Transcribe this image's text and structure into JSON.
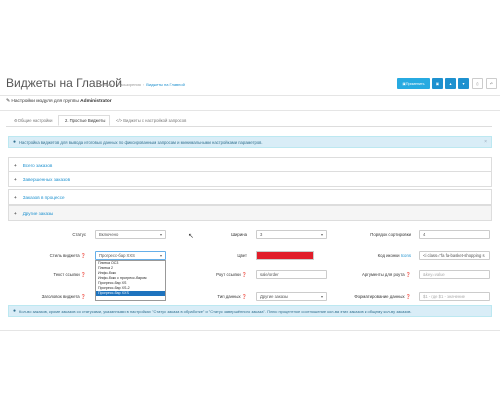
{
  "header": {
    "title": "Виджеты на Главной",
    "breadcrumb": [
      "Главная",
      "Расширения",
      "Виджеты на Главной"
    ]
  },
  "toolbar": {
    "apply_label": "Применить",
    "save_icon": "save-icon",
    "copy_icon": "copy-icon",
    "download_icon": "download-icon",
    "file_icon": "file-icon",
    "back_icon": "back-icon"
  },
  "panel": {
    "heading_prefix": "Настройки модуля для группы",
    "heading_group": "Administrator"
  },
  "tabs": [
    {
      "label": "Общие настройки"
    },
    {
      "label": "2. Простые Виджеты"
    },
    {
      "label": "</> Виджеты с настройкой запросов"
    }
  ],
  "info_alert": "Настройка виджетов для вывода итоговых данных по фиксированным запросам и минимальными настройками параметров.",
  "accordion": [
    {
      "label": "Всего заказов"
    },
    {
      "label": "Завершенных заказов"
    },
    {
      "label": "Заказов в процессе"
    },
    {
      "label": "Другие заказы"
    }
  ],
  "form": {
    "status": {
      "label": "Статус",
      "value": "Включено"
    },
    "width": {
      "label": "Ширина",
      "value": "3"
    },
    "sort_order": {
      "label": "Порядок сортировки",
      "value": "4"
    },
    "widget_style": {
      "label": "Стиль виджета",
      "value": "Прогресс-бар XXS"
    },
    "color": {
      "label": "Цвет",
      "value": "#e11d2a"
    },
    "icon_code": {
      "label": "Код иконки",
      "link": "Icons",
      "value": "<i class=\"fa fa-basket-shopping s"
    },
    "link_text": {
      "label": "Текст ссылки",
      "value": ""
    },
    "link_route": {
      "label": "Роут ссылки",
      "value": "sale/order"
    },
    "route_args": {
      "label": "Аргументы для роута",
      "placeholder": "&key=value"
    },
    "widget_heading": {
      "label": "Заголовок виджета",
      "value": ""
    },
    "data_type": {
      "label": "Тип данных",
      "value": "Другие заказы"
    },
    "data_format": {
      "label": "Форматирование данных",
      "placeholder": "$1 - где $1 - значение"
    }
  },
  "style_options": [
    "Плитка OC3",
    "Плитка 2",
    "Инфо-бокс",
    "Инфо-бокс с прогресс-баром",
    "Прогресс-бар XS",
    "Прогресс-бар XS-2",
    "Прогресс-бар XXS"
  ],
  "bottom_alert": "Кол-во заказов, кроме заказов со статусами, указанными в настройках \"Статус заказа в обработке\" и \"Статус завершённого заказа\". Плюс процентное соотношение кол-ва этих заказов к общему кол-ву заказов.",
  "colors": {
    "primary": "#1e91cf",
    "accent": "#27aae1",
    "info_bg": "#d9edf7",
    "info_text": "#31708f",
    "red_swatch": "#e11d2a",
    "selected_item": "#1e73be"
  }
}
